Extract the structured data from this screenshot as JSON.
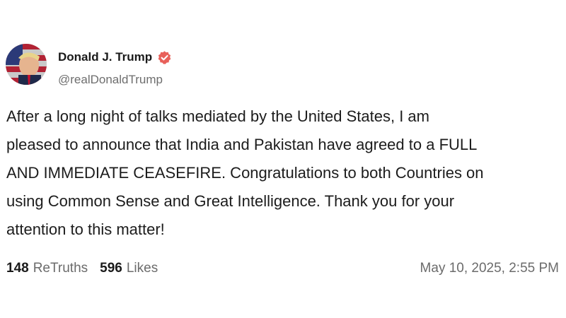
{
  "author": {
    "display_name": "Donald J. Trump",
    "handle": "@realDonaldTrump",
    "avatar_icon": "profile-avatar",
    "verified_icon": "verified-badge-icon",
    "verified_color": "#e8605a"
  },
  "post": {
    "text": "After a long night of talks mediated by the United States, I am\npleased to announce that India and Pakistan have agreed to a FULL\nAND IMMEDIATE CEASEFIRE. Congratulations to both Countries on\nusing Common Sense and Great Intelligence. Thank you for your\nattention to this matter!"
  },
  "stats": {
    "retruths_count": "148",
    "retruths_label": "ReTruths",
    "likes_count": "596",
    "likes_label": "Likes",
    "timestamp": "May 10, 2025, 2:55 PM"
  }
}
